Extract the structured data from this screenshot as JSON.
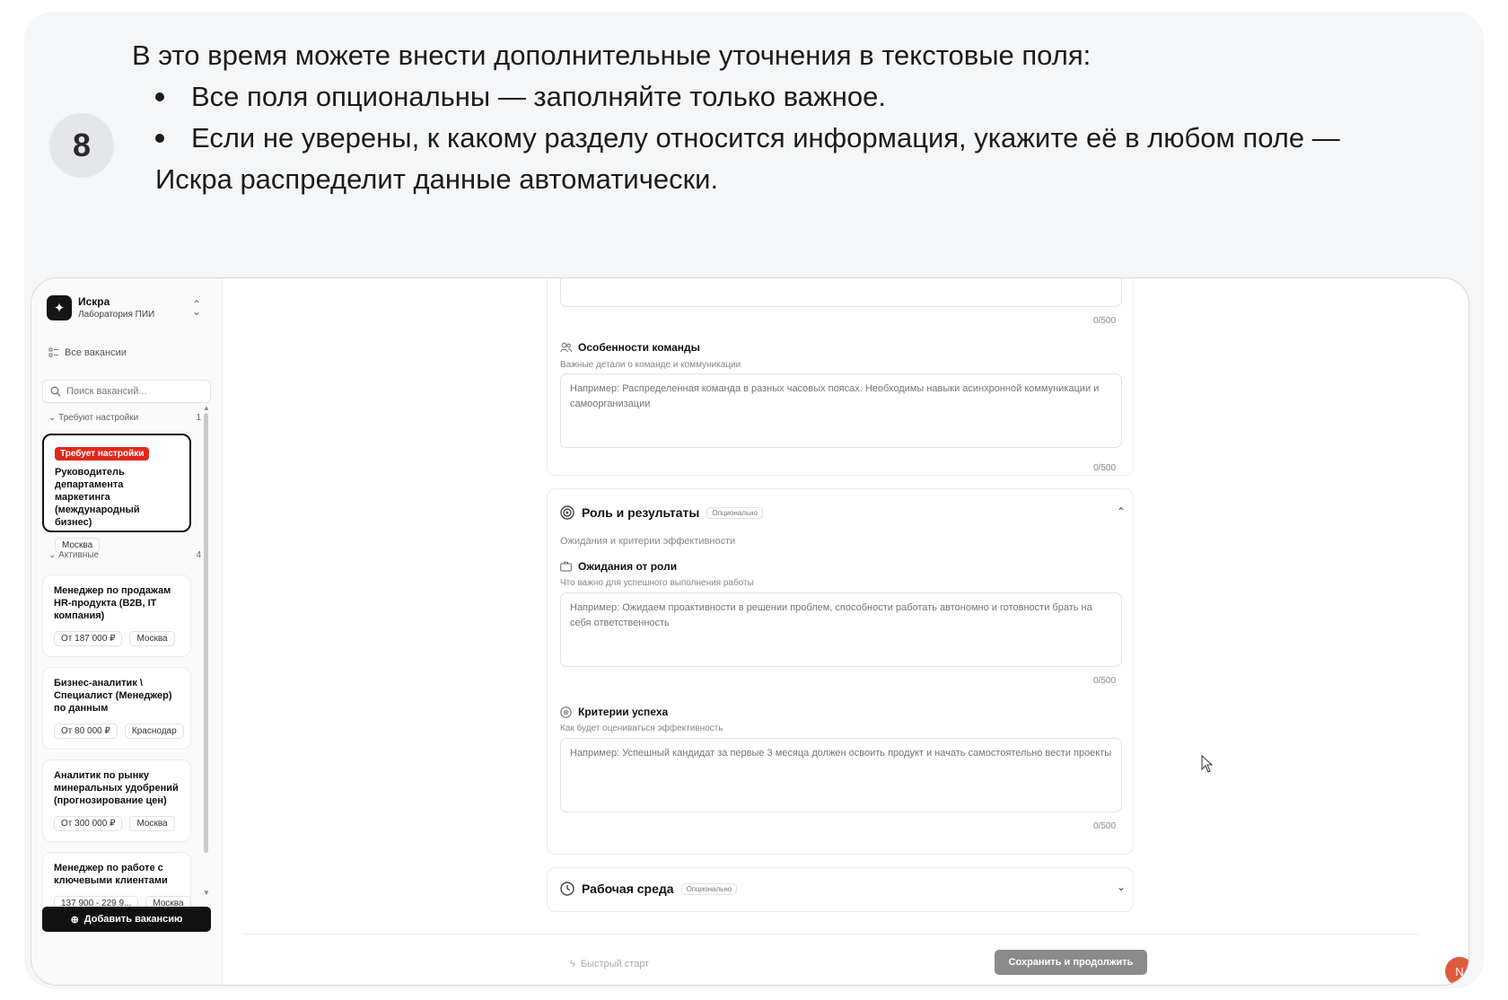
{
  "step": {
    "number": "8"
  },
  "instructions": {
    "intro": "В это время можете внести дополнительные уточнения в текстовые поля:",
    "bullet1": "Все поля опциональны — заполняйте только важное.",
    "bullet2": "Если не уверены, к какому разделу относится информация, укажите её в любом поле —",
    "bullet2_cont": "Искра распределит данные автоматически."
  },
  "sidebar": {
    "brand_name": "Искра",
    "brand_sub": "Лаборатория ПИИ",
    "all_vacancies": "Все вакансии",
    "search_placeholder": "Поиск вакансий...",
    "needs_setup": {
      "label": "Требуют настройки",
      "count": "1"
    },
    "setup_badge": "Требует настройки",
    "setup_card": {
      "title": "Руководитель департамента маркетинга (международный бизнес)",
      "tags": [
        "Москва"
      ]
    },
    "active": {
      "label": "Активные",
      "count": "4"
    },
    "active_cards": [
      {
        "title": "Менеджер по продажам HR-продукта (B2B, IT компания)",
        "tags": [
          "От 187 000 ₽",
          "Москва"
        ]
      },
      {
        "title": "Бизнес-аналитик \\ Специалист (Менеджер) по данным",
        "tags": [
          "От 80 000 ₽",
          "Краснодар"
        ]
      },
      {
        "title": "Аналитик по рынку минеральных удобрений (прогнозирование цен)",
        "tags": [
          "От 300 000 ₽",
          "Москва"
        ]
      },
      {
        "title": "Менеджер по работе с ключевыми клиентами",
        "tags": [
          "137 900 - 229 9...",
          "Москва"
        ]
      }
    ],
    "add_button": "Добавить вакансию"
  },
  "form": {
    "top_counter": "0/500",
    "team": {
      "label": "Особенности команды",
      "hint": "Важные детали о команде и коммуникации",
      "placeholder": "Например: Распределенная команда в разных часовых поясах. Необходимы навыки асинхронной коммуникации и самоорганизации",
      "counter": "0/500"
    },
    "role_section": {
      "title": "Роль и результаты",
      "badge": "Опционально",
      "subtitle": "Ожидания и критерии эффективности"
    },
    "expectations": {
      "label": "Ожидания от роли",
      "hint": "Что важно для успешного выполнения работы",
      "placeholder": "Например: Ожидаем проактивности в решении проблем, способности работать автономно и готовности брать на себя ответственность",
      "counter": "0/500"
    },
    "success": {
      "label": "Критерии успеха",
      "hint": "Как будет оцениваться эффективность",
      "placeholder": "Например: Успешный кандидат за первые 3 месяца должен освоить продукт и начать самостоятельно вести проекты",
      "counter": "0/500"
    },
    "env_section": {
      "title": "Рабочая среда",
      "badge": "Опционально"
    }
  },
  "footer": {
    "quick_start": "Быстрый старт",
    "save": "Сохранить и продолжить",
    "avatar": "N"
  }
}
